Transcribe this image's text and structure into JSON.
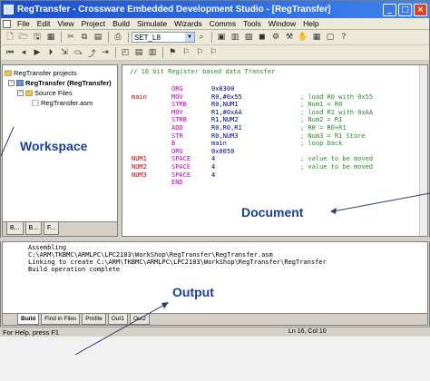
{
  "window": {
    "title": "RegTransfer - Crossware Embedded Development Studio - [RegTransfer]",
    "controls": [
      "_",
      "□",
      "×"
    ]
  },
  "menu": [
    "File",
    "Edit",
    "View",
    "Project",
    "Build",
    "Simulate",
    "Wizards",
    "Comms",
    "Tools",
    "Window",
    "Help"
  ],
  "toolbar": {
    "combo_value": "SET_L8"
  },
  "workspace": {
    "tree": [
      "RegTransfer projects",
      "RegTransfer (RegTransfer)",
      "Source Files",
      "RegTransfer.asm"
    ],
    "tabs": [
      "B...",
      "B...",
      "F..."
    ]
  },
  "editor": {
    "header_comment": "// 16 bit Register based data Transfer",
    "lines": [
      {
        "label": "",
        "op": "ORG",
        "args": "0x0300",
        "comment": ""
      },
      {
        "label": "main",
        "op": "MOV",
        "args": "R0,#0x55",
        "comment": "; load R0 with 0x55"
      },
      {
        "label": "",
        "op": "STRB",
        "args": "R0,NUM1",
        "comment": "; Num1 = R0"
      },
      {
        "label": "",
        "op": "MOV",
        "args": "R1,#0xAA",
        "comment": "; load R1 with 0xAA"
      },
      {
        "label": "",
        "op": "STRB",
        "args": "R1,NUM2",
        "comment": "; Num2 = R1"
      },
      {
        "label": "",
        "op": "ADD",
        "args": "R0,R0,R1",
        "comment": "; R0 = R0+R1"
      },
      {
        "label": "",
        "op": "STR",
        "args": "R0,NUM3",
        "comment": "; Num3 = R1 Store"
      },
      {
        "label": "",
        "op": "B",
        "args": "main",
        "comment": "; loop back"
      },
      {
        "label": "",
        "op": "ORG",
        "args": "0x0050",
        "comment": ""
      },
      {
        "label": "NUM1",
        "op": "SPACE",
        "args": "4",
        "comment": "; value to be moved"
      },
      {
        "label": "NUM2",
        "op": "SPACE",
        "args": "4",
        "comment": "; value to be moved"
      },
      {
        "label": "NUM3",
        "op": "SPACE",
        "args": "4",
        "comment": ""
      },
      {
        "label": "",
        "op": "END",
        "args": "",
        "comment": ""
      }
    ]
  },
  "output": {
    "lines": [
      "Assembling",
      "C:\\ARM\\TKBMC\\ARMLPC\\LPC2103\\WorkShop\\RegTransfer\\RegTransfer.asm",
      "Linking to create C:\\ARM\\TKBMC\\ARMLPC\\LPC2103\\WorkShop\\RegTransfer\\RegTransfer",
      "Build operation complete"
    ],
    "tabs": [
      "Build",
      "Find in Files",
      "Profile",
      "Out1",
      "Out2"
    ]
  },
  "status": {
    "left": "For Help, press F1",
    "position": "Ln 16, Col 10"
  },
  "callouts": {
    "workspace": "Workspace",
    "document": "Document",
    "output": "Output"
  }
}
